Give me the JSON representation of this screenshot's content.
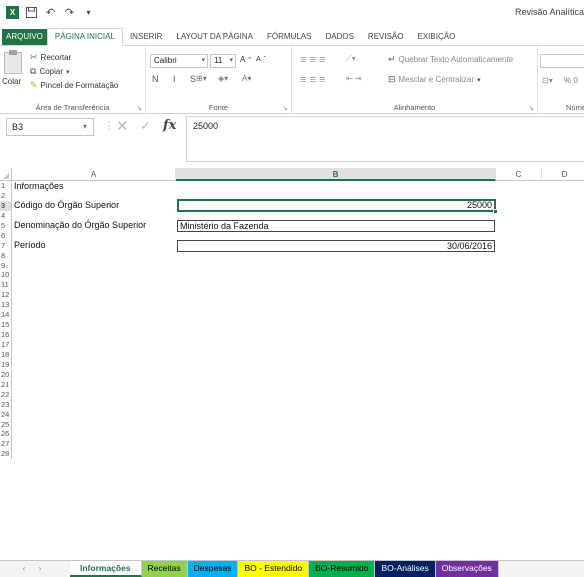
{
  "window": {
    "title": "Revisão Analítica",
    "quick_access": [
      "save-icon",
      "undo-icon",
      "redo-icon",
      "customize-icon"
    ]
  },
  "ribbon_tabs": [
    {
      "label": "ARQUIVO"
    },
    {
      "label": "PÁGINA INICIAL"
    },
    {
      "label": "INSERIR"
    },
    {
      "label": "LAYOUT DA PÁGINA"
    },
    {
      "label": "FÓRMULAS"
    },
    {
      "label": "DADOS"
    },
    {
      "label": "REVISÃO"
    },
    {
      "label": "EXIBIÇÃO"
    }
  ],
  "ribbon": {
    "clipboard": {
      "label": "Área de Transferência",
      "paste": "Colar",
      "cut": "Recortar",
      "copy": "Copiar",
      "format_painter": "Pincel de Formatação"
    },
    "font": {
      "label": "Fonte",
      "font_name": "Calibri",
      "font_size": "11",
      "format_buttons": "N I S"
    },
    "alignment": {
      "label": "Alinhamento",
      "wrap_text": "Quebrar Texto Automaticamente",
      "merge_center": "Mesclar e Centralizar"
    },
    "number": {
      "label": "Núme",
      "percent": "% 0"
    }
  },
  "formula_bar": {
    "name_box": "B3",
    "fx": "fx",
    "value": "25000"
  },
  "grid": {
    "columns": [
      "A",
      "B",
      "C",
      "D"
    ],
    "selected_column": "B",
    "rows": [
      "1",
      "2",
      "3",
      "4",
      "5",
      "6",
      "7",
      "8",
      "9",
      "10",
      "11",
      "12",
      "13",
      "14",
      "15",
      "16",
      "17",
      "18",
      "19",
      "20",
      "21",
      "22",
      "23",
      "24",
      "25",
      "26",
      "27",
      "28"
    ],
    "selected_row": "3",
    "cells": {
      "a1": "Informações",
      "a3": "Código do Órgão Superior",
      "b3": "25000",
      "a5": "Denominação do Órgão Superior",
      "b5": "Ministério da Fazenda",
      "a7": "Período",
      "b7": "30/06/2016"
    }
  },
  "sheet_tabs": [
    {
      "label": "Informações",
      "color": "#ffffff"
    },
    {
      "label": "Receitas",
      "color": "#92d050"
    },
    {
      "label": "Despesas",
      "color": "#00b0f0"
    },
    {
      "label": "BO - Estendido",
      "color": "#ffff00"
    },
    {
      "label": "BO-Resumido",
      "color": "#00b050"
    },
    {
      "label": "BO-Análises",
      "color": "#002060"
    },
    {
      "label": "Observações",
      "color": "#7030a0"
    }
  ]
}
